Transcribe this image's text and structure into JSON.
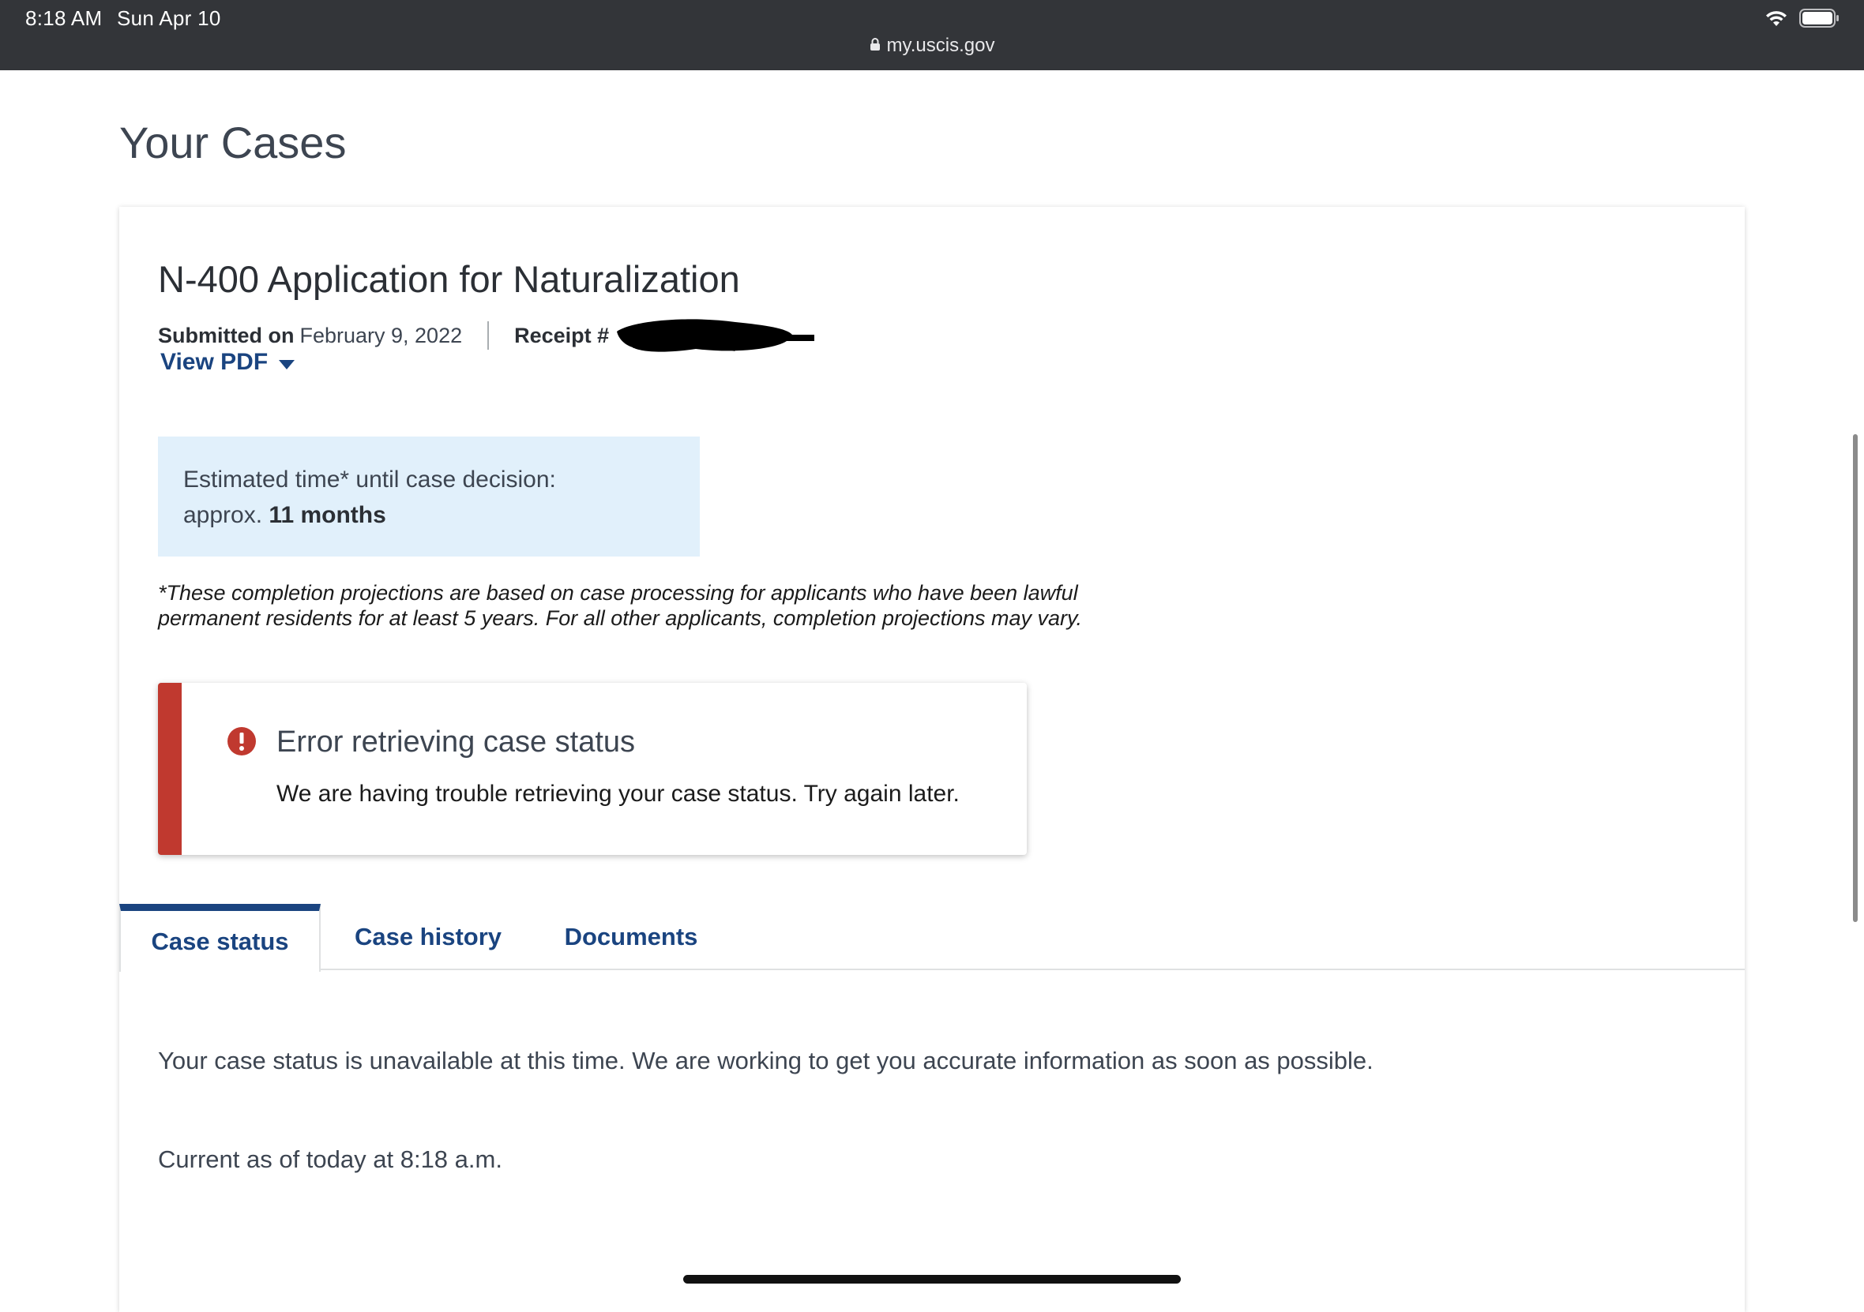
{
  "status_bar": {
    "time": "8:18 AM",
    "date": "Sun Apr 10",
    "url": "my.uscis.gov"
  },
  "page": {
    "title": "Your Cases"
  },
  "case": {
    "title": "N-400 Application for Naturalization",
    "submitted_label": "Submitted on",
    "submitted_date": "February 9, 2022",
    "receipt_label": "Receipt #",
    "view_pdf_label": "View PDF",
    "estimate_line1": "Estimated time* until case decision:",
    "estimate_prefix": "approx.",
    "estimate_value": "11 months",
    "footnote_line1": "*These completion projections are based on case processing for applicants who have been lawful",
    "footnote_line2": "permanent residents for at least 5 years. For all other applicants, completion projections may vary."
  },
  "alert": {
    "title": "Error retrieving case status",
    "body": "We are having trouble retrieving your case status. Try again later.",
    "color": "#c0392f"
  },
  "tabs": [
    {
      "label": "Case status",
      "active": true
    },
    {
      "label": "Case history",
      "active": false
    },
    {
      "label": "Documents",
      "active": false
    }
  ],
  "tab_content": {
    "status_text": "Your case status is unavailable at this time. We are working to get you accurate information as soon as possible.",
    "current_as_of": "Current as of today at 8:18 a.m."
  },
  "colors": {
    "status_bar_bg": "#333539",
    "link": "#1a4480",
    "estimate_bg": "#e1f0fb"
  },
  "icons": {
    "lock": "lock-icon",
    "wifi": "wifi-icon",
    "battery": "battery-icon",
    "view_pdf_caret": "caret-down-icon",
    "alert": "error-icon"
  }
}
